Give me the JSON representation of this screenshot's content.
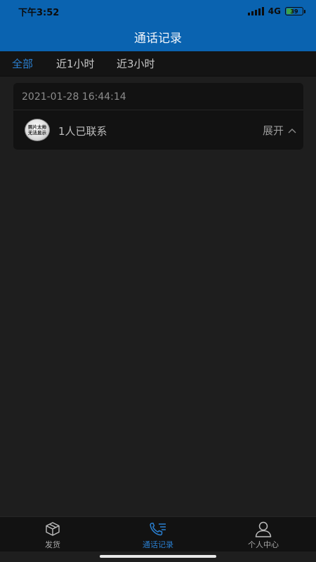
{
  "status_bar": {
    "time": "下午3:52",
    "network": "4G",
    "battery": "39"
  },
  "header": {
    "title": "通话记录"
  },
  "tabs": [
    {
      "label": "全部",
      "active": true
    },
    {
      "label": "近1小时",
      "active": false
    },
    {
      "label": "近3小时",
      "active": false
    }
  ],
  "records": [
    {
      "time": "2021-01-28 16:44:14",
      "avatar_text": [
        "照片太帅",
        "无法显示"
      ],
      "summary": "1人已联系",
      "expand_label": "展开",
      "expand_icon": "chevron-up-icon"
    }
  ],
  "bottom_nav": [
    {
      "label": "发货",
      "icon": "package-icon",
      "active": false
    },
    {
      "label": "通话记录",
      "icon": "phone-call-log-icon",
      "active": true
    },
    {
      "label": "个人中心",
      "icon": "user-icon",
      "active": false
    }
  ],
  "colors": {
    "brand": "#0a63b0",
    "active": "#2a7fd0",
    "background": "#1e1e1e"
  }
}
